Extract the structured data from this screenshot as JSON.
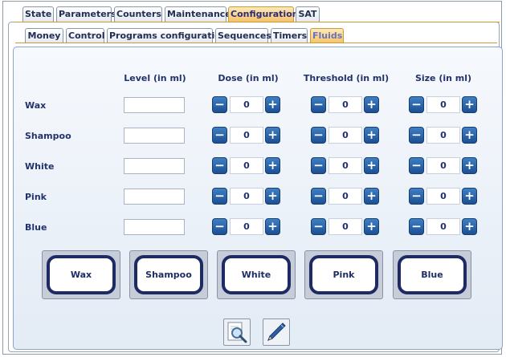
{
  "main_tabs": [
    {
      "label": "State"
    },
    {
      "label": "Parameters"
    },
    {
      "label": "Counters"
    },
    {
      "label": "Maintenance"
    },
    {
      "label": "Configuration"
    },
    {
      "label": "SAT"
    }
  ],
  "active_main_tab": "Configuration",
  "sub_tabs": [
    {
      "label": "Money"
    },
    {
      "label": "Control"
    },
    {
      "label": "Programs configuration"
    },
    {
      "label": "Sequences"
    },
    {
      "label": "Timers"
    },
    {
      "label": "Fluids"
    }
  ],
  "active_sub_tab": "Fluids",
  "columns": {
    "level": "Level (in ml)",
    "dose": "Dose (in ml)",
    "threshold": "Threshold (in ml)",
    "size": "Size (in ml)"
  },
  "rows": [
    {
      "label": "Wax",
      "level": "",
      "dose": "0",
      "threshold": "0",
      "size": "0"
    },
    {
      "label": "Shampoo",
      "level": "",
      "dose": "0",
      "threshold": "0",
      "size": "0"
    },
    {
      "label": "White",
      "level": "",
      "dose": "0",
      "threshold": "0",
      "size": "0"
    },
    {
      "label": "Pink",
      "level": "",
      "dose": "0",
      "threshold": "0",
      "size": "0"
    },
    {
      "label": "Blue",
      "level": "",
      "dose": "0",
      "threshold": "0",
      "size": "0"
    }
  ],
  "stepper_glyphs": {
    "minus": "−",
    "plus": "+"
  },
  "fluid_buttons": [
    {
      "label": "Wax"
    },
    {
      "label": "Shampoo"
    },
    {
      "label": "White"
    },
    {
      "label": "Pink"
    },
    {
      "label": "Blue"
    }
  ],
  "actions": {
    "preview_icon": "magnifier-icon",
    "edit_icon": "pen-icon"
  },
  "colors": {
    "active_tab": "#f5c36a",
    "button_blue": "#1c4f93",
    "text": "#22336b"
  }
}
